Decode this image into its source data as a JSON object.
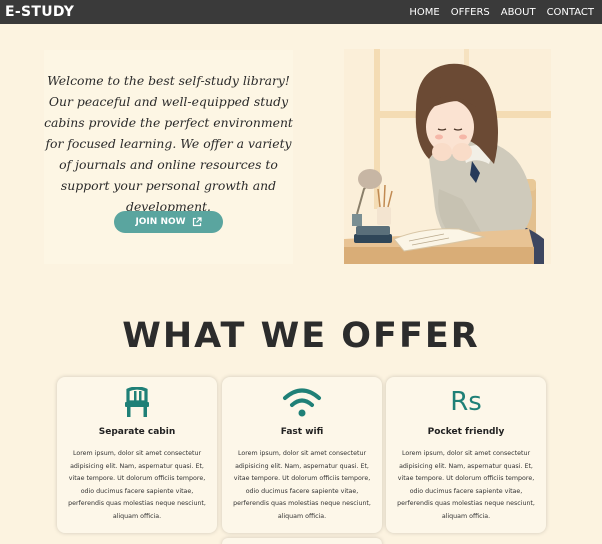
{
  "navbar": {
    "brand": "E-STUDY",
    "links": [
      "HOME",
      "OFFERS",
      "ABOUT",
      "CONTACT"
    ]
  },
  "hero": {
    "text": "Welcome to the best self-study library! Our peaceful and well-equipped study cabins provide the perfect environment for focused learning. We offer a variety of journals and online resources to support your personal growth and development.",
    "button_label": "JOIN NOW",
    "button_icon": "external-link-icon"
  },
  "offers": {
    "title": "WHAT WE OFFER",
    "cards": [
      {
        "icon": "chair-icon",
        "title": "Separate cabin",
        "text": "Lorem ipsum, dolor sit amet consectetur adipisicing elit. Nam, aspernatur quasi. Et, vitae tempore. Ut dolorum officiis tempore, odio ducimus facere sapiente vitae, perferendis quas molestias neque nesciunt, aliquam officia."
      },
      {
        "icon": "wifi-icon",
        "title": "Fast wifi",
        "text": "Lorem ipsum, dolor sit amet consectetur adipisicing elit. Nam, aspernatur quasi. Et, vitae tempore. Ut dolorum officiis tempore, odio ducimus facere sapiente vitae, perferendis quas molestias neque nesciunt, aliquam officia."
      },
      {
        "icon": "rupee-icon",
        "icon_text": "Rs",
        "title": "Pocket friendly",
        "text": "Lorem ipsum, dolor sit amet consectetur adipisicing elit. Nam, aspernatur quasi. Et, vitae tempore. Ut dolorum officiis tempore, odio ducimus facere sapiente vitae, perferendis quas molestias neque nesciunt, aliquam officia."
      }
    ]
  },
  "colors": {
    "background": "#fcf3e0",
    "navbar": "#3a3a3a",
    "accent": "#5aa59f",
    "icon": "#1f8077"
  }
}
